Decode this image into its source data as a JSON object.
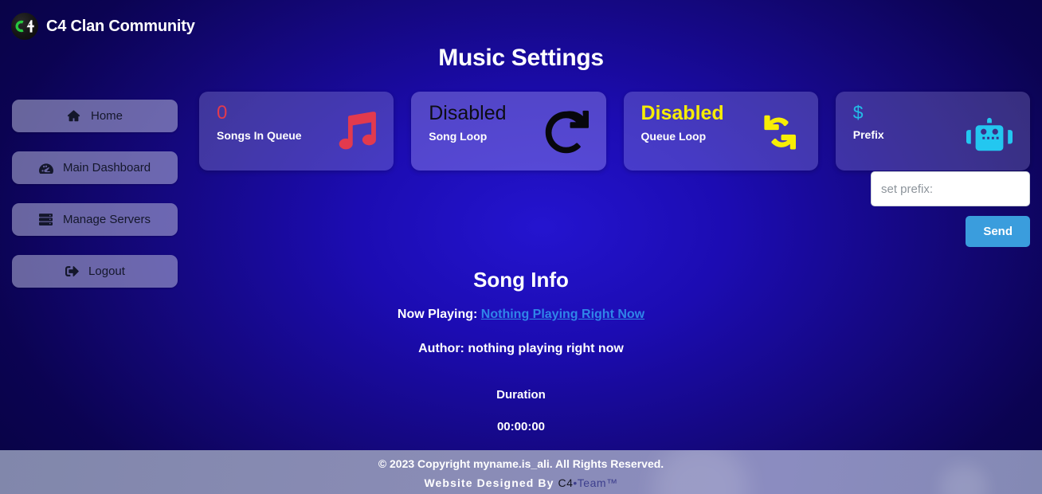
{
  "header": {
    "brand_name": "C4 Clan Community",
    "logo_icon": "c4-logo-icon",
    "page_title": "Music Settings"
  },
  "sidebar": {
    "items": [
      {
        "label": "Home",
        "icon": "home-icon"
      },
      {
        "label": "Main Dashboard",
        "icon": "dashboard-gauge-icon"
      },
      {
        "label": "Manage Servers",
        "icon": "server-rack-icon"
      },
      {
        "label": "Logout",
        "icon": "sign-out-icon"
      }
    ]
  },
  "cards": [
    {
      "value": "0",
      "label": "Songs In Queue",
      "icon": "music-note-icon",
      "color": "#e23a4e"
    },
    {
      "value": "Disabled",
      "label": "Song Loop",
      "icon": "redo-arrow-icon",
      "color": "#07070c"
    },
    {
      "value": "Disabled",
      "label": "Queue Loop",
      "icon": "sync-loop-icon",
      "color": "#f7ed05"
    },
    {
      "value": "$",
      "label": "Prefix",
      "icon": "robot-icon",
      "color": "#23c7f0"
    }
  ],
  "prefix_form": {
    "input_value": "",
    "placeholder": "set prefix:",
    "send_label": "Send",
    "send_color": "#3a9ddd"
  },
  "song_info": {
    "title": "Song Info",
    "now_playing_label": "Now Playing:",
    "now_playing_link": "Nothing Playing Right Now",
    "link_color": "#2f86e8",
    "author_text": "Author: nothing playing right now"
  },
  "duration": {
    "label": "Duration",
    "value": "00:00:00"
  },
  "footer": {
    "copyright": "© 2023 Copyright myname.is_ali. All Rights Reserved.",
    "designed_by_prefix": "Website Designed By ",
    "designed_by_c4": "C4",
    "designed_by_team": "•Team™"
  }
}
